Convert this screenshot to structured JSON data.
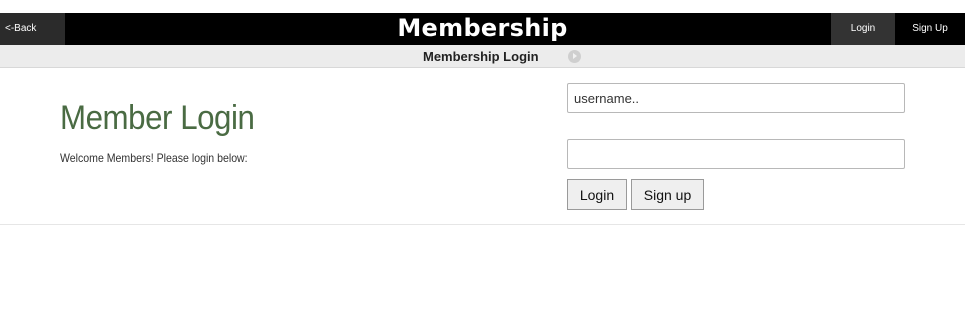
{
  "header": {
    "back_label": "<-Back",
    "title": "Membership",
    "login_label": "Login",
    "signup_label": "Sign Up"
  },
  "subheader": {
    "title": "Membership Login",
    "arrow_icon": "circle-arrow-right-icon"
  },
  "main": {
    "heading": "Member Login",
    "welcome_text": "Welcome Members! Please login below:"
  },
  "form": {
    "username_placeholder": "username..",
    "username_value": "",
    "password_value": "",
    "login_button": "Login",
    "signup_button": "Sign up"
  },
  "colors": {
    "topbar": "#000000",
    "heading": "#4a6b43",
    "subbar": "#ececec"
  }
}
